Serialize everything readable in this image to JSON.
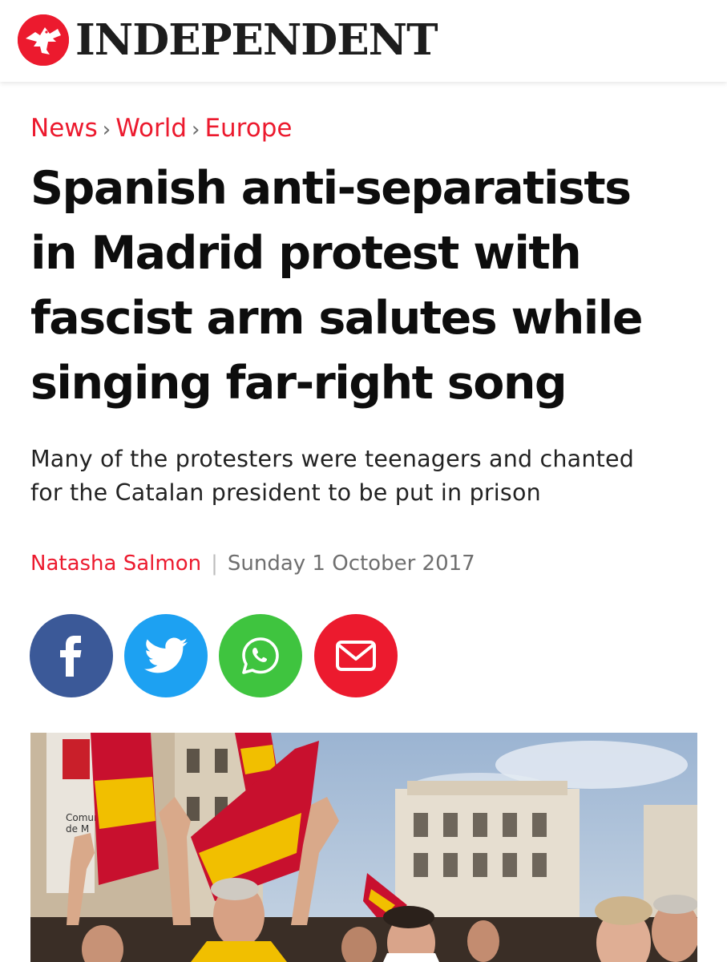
{
  "header": {
    "logo_text": "INDEPENDENT",
    "logo_icon": "eagle-icon",
    "brand_color": "#ec1a2e"
  },
  "breadcrumb": {
    "items": [
      "News",
      "World",
      "Europe"
    ],
    "separator": "›"
  },
  "article": {
    "headline_lines": [
      "Spanish anti-separatists",
      "in Madrid protest with",
      "fascist arm salutes while",
      "singing far-right song"
    ],
    "subtitle_lines": [
      "Many of the protesters were teenagers and chanted",
      "for the Catalan president to be put in prison"
    ],
    "author": "Natasha Salmon",
    "byline_divider": "|",
    "date": "Sunday 1 October 2017"
  },
  "share": {
    "buttons": [
      {
        "name": "facebook",
        "icon": "facebook-icon",
        "color": "#3b5998"
      },
      {
        "name": "twitter",
        "icon": "twitter-icon",
        "color": "#1da1f2"
      },
      {
        "name": "whatsapp",
        "icon": "whatsapp-icon",
        "color": "#3fc43f"
      },
      {
        "name": "email",
        "icon": "mail-icon",
        "color": "#ec1a2e"
      }
    ]
  },
  "photo": {
    "sign_text_1": "Comun",
    "sign_text_2": "de M"
  }
}
